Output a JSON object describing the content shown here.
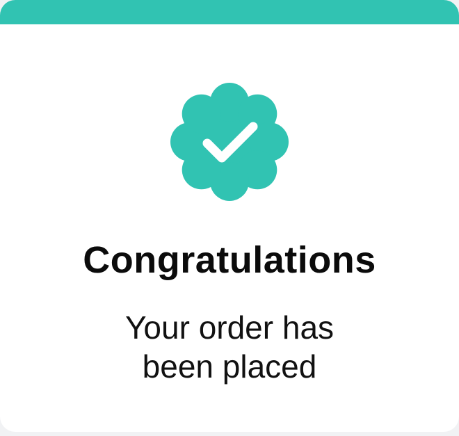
{
  "colors": {
    "accent": "#31c3b2",
    "background": "#ffffff",
    "text": "#0b0b0b"
  },
  "icon": {
    "name": "verified-check-badge-icon"
  },
  "dialog": {
    "title": "Congratulations",
    "message_line1": "Your order has",
    "message_line2": "been placed"
  }
}
